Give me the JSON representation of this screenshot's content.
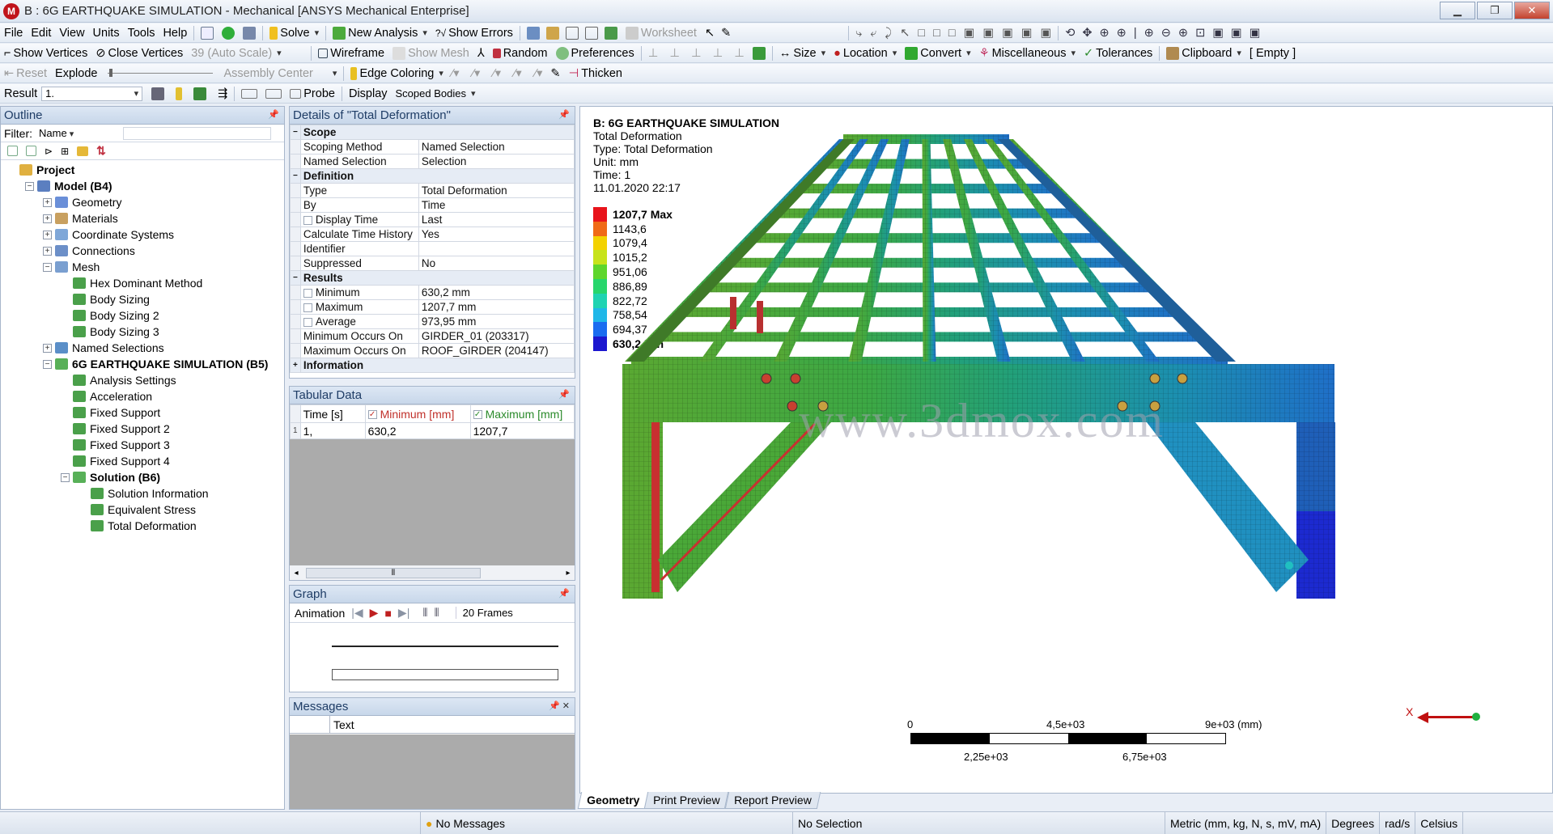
{
  "window": {
    "title": "B : 6G EARTHQUAKE SIMULATION - Mechanical [ANSYS Mechanical Enterprise]",
    "app_icon_letter": "M"
  },
  "menu": [
    "File",
    "Edit",
    "View",
    "Units",
    "Tools",
    "Help"
  ],
  "toolbar1": {
    "solve": "Solve",
    "new_analysis": "New Analysis",
    "show_errors": "Show Errors",
    "worksheet": "Worksheet"
  },
  "toolbar2": {
    "show_vertices": "Show Vertices",
    "close_vertices": "Close Vertices",
    "auto_scale": "39 (Auto Scale)",
    "wireframe": "Wireframe",
    "show_mesh": "Show Mesh",
    "random": "Random",
    "preferences": "Preferences",
    "size": "Size",
    "location": "Location",
    "convert": "Convert",
    "misc": "Miscellaneous",
    "tolerances": "Tolerances",
    "clipboard": "Clipboard",
    "empty": "[ Empty ]"
  },
  "toolbar3": {
    "reset": "Reset",
    "explode": "Explode",
    "assembly_center": "Assembly Center",
    "edge_coloring": "Edge Coloring",
    "thicken": "Thicken"
  },
  "toolbar4": {
    "result_label": "Result",
    "result_value": "1.",
    "probe": "Probe",
    "display_label": "Display",
    "display_value": "Scoped Bodies"
  },
  "outline": {
    "title": "Outline",
    "filter_label": "Filter:",
    "filter_value": "Name",
    "nodes": [
      {
        "label": "Project",
        "indent": 0,
        "bold": true,
        "toggle": "",
        "icon": "#e0b040"
      },
      {
        "label": "Model (B4)",
        "indent": 1,
        "bold": true,
        "toggle": "−",
        "icon": "#5b7fc0"
      },
      {
        "label": "Geometry",
        "indent": 2,
        "bold": false,
        "toggle": "+",
        "icon": "#6a8fd8"
      },
      {
        "label": "Materials",
        "indent": 2,
        "bold": false,
        "toggle": "+",
        "icon": "#c8a060"
      },
      {
        "label": "Coordinate Systems",
        "indent": 2,
        "bold": false,
        "toggle": "+",
        "icon": "#7fa7d8"
      },
      {
        "label": "Connections",
        "indent": 2,
        "bold": false,
        "toggle": "+",
        "icon": "#6c8fc8"
      },
      {
        "label": "Mesh",
        "indent": 2,
        "bold": false,
        "toggle": "−",
        "icon": "#7a9fd0"
      },
      {
        "label": "Hex Dominant Method",
        "indent": 3,
        "bold": false,
        "toggle": "",
        "icon": "#4aa04a"
      },
      {
        "label": "Body Sizing",
        "indent": 3,
        "bold": false,
        "toggle": "",
        "icon": "#4aa04a"
      },
      {
        "label": "Body Sizing 2",
        "indent": 3,
        "bold": false,
        "toggle": "",
        "icon": "#4aa04a"
      },
      {
        "label": "Body Sizing 3",
        "indent": 3,
        "bold": false,
        "toggle": "",
        "icon": "#4aa04a"
      },
      {
        "label": "Named Selections",
        "indent": 2,
        "bold": false,
        "toggle": "+",
        "icon": "#5b8fc8"
      },
      {
        "label": "6G EARTHQUAKE SIMULATION (B5)",
        "indent": 2,
        "bold": true,
        "toggle": "−",
        "icon": "#58b058"
      },
      {
        "label": "Analysis Settings",
        "indent": 3,
        "bold": false,
        "toggle": "",
        "icon": "#4aa04a"
      },
      {
        "label": "Acceleration",
        "indent": 3,
        "bold": false,
        "toggle": "",
        "icon": "#4aa04a"
      },
      {
        "label": "Fixed Support",
        "indent": 3,
        "bold": false,
        "toggle": "",
        "icon": "#4aa04a"
      },
      {
        "label": "Fixed Support 2",
        "indent": 3,
        "bold": false,
        "toggle": "",
        "icon": "#4aa04a"
      },
      {
        "label": "Fixed Support 3",
        "indent": 3,
        "bold": false,
        "toggle": "",
        "icon": "#4aa04a"
      },
      {
        "label": "Fixed Support 4",
        "indent": 3,
        "bold": false,
        "toggle": "",
        "icon": "#4aa04a"
      },
      {
        "label": "Solution (B6)",
        "indent": 3,
        "bold": true,
        "toggle": "−",
        "icon": "#58b058"
      },
      {
        "label": "Solution Information",
        "indent": 4,
        "bold": false,
        "toggle": "",
        "icon": "#4aa04a"
      },
      {
        "label": "Equivalent Stress",
        "indent": 4,
        "bold": false,
        "toggle": "",
        "icon": "#4aa04a"
      },
      {
        "label": "Total Deformation",
        "indent": 4,
        "bold": false,
        "toggle": "",
        "icon": "#4aa04a"
      }
    ]
  },
  "details": {
    "title": "Details of \"Total Deformation\"",
    "rows": [
      {
        "type": "sec",
        "k": "Scope"
      },
      {
        "k": "Scoping Method",
        "v": "Named Selection"
      },
      {
        "k": "Named Selection",
        "v": "Selection"
      },
      {
        "type": "sec",
        "k": "Definition"
      },
      {
        "k": "Type",
        "v": "Total Deformation"
      },
      {
        "k": "By",
        "v": "Time"
      },
      {
        "k": "Display Time",
        "v": "Last",
        "chk": true
      },
      {
        "k": "Calculate Time History",
        "v": "Yes"
      },
      {
        "k": "Identifier",
        "v": ""
      },
      {
        "k": "Suppressed",
        "v": "No"
      },
      {
        "type": "sec",
        "k": "Results"
      },
      {
        "k": "Minimum",
        "v": "630,2 mm",
        "chk": true
      },
      {
        "k": "Maximum",
        "v": "1207,7 mm",
        "chk": true
      },
      {
        "k": "Average",
        "v": "973,95 mm",
        "chk": true
      },
      {
        "k": "Minimum Occurs On",
        "v": "GIRDER_01 (203317)"
      },
      {
        "k": "Maximum Occurs On",
        "v": "ROOF_GIRDER (204147)"
      },
      {
        "type": "sec",
        "k": "Information",
        "collapsed": true
      }
    ]
  },
  "tabular": {
    "title": "Tabular Data",
    "col_time": "Time [s]",
    "col_min": "Minimum [mm]",
    "col_max": "Maximum [mm]",
    "row": {
      "idx": "1",
      "time": "1,",
      "min": "630,2",
      "max": "1207,7"
    }
  },
  "graph": {
    "title": "Graph",
    "animation": "Animation",
    "frames": "20 Frames"
  },
  "messages": {
    "title": "Messages",
    "col_text": "Text"
  },
  "viewport": {
    "header": [
      "B: 6G EARTHQUAKE SIMULATION",
      "Total Deformation",
      "Type: Total Deformation",
      "Unit: mm",
      "Time: 1",
      "11.01.2020 22:17"
    ],
    "legend": [
      {
        "label": "1207,7 Max",
        "color": "#e8141b",
        "bold": true
      },
      {
        "label": "1143,6",
        "color": "#f06a16"
      },
      {
        "label": "1079,4",
        "color": "#f3d200"
      },
      {
        "label": "1015,2",
        "color": "#c7e31b"
      },
      {
        "label": "951,06",
        "color": "#5ed62c"
      },
      {
        "label": "886,89",
        "color": "#27d66c"
      },
      {
        "label": "822,72",
        "color": "#1fd3b2"
      },
      {
        "label": "758,54",
        "color": "#1fb7e8"
      },
      {
        "label": "694,37",
        "color": "#1a6cf0"
      },
      {
        "label": "630,2 Min",
        "color": "#1c17cf",
        "bold": true
      }
    ],
    "scale": {
      "t0": "0",
      "t1": "4,5e+03",
      "t2": "9e+03 (mm)",
      "b1": "2,25e+03",
      "b2": "6,75e+03"
    },
    "axis_label": "X",
    "watermark": "www.3dmox.com",
    "tabs": [
      "Geometry",
      "Print Preview",
      "Report Preview"
    ]
  },
  "status": {
    "messages": "No Messages",
    "selection": "No Selection",
    "units": "Metric (mm, kg, N, s, mV, mA)",
    "angle": "Degrees",
    "rot": "rad/s",
    "temp": "Celsius"
  }
}
